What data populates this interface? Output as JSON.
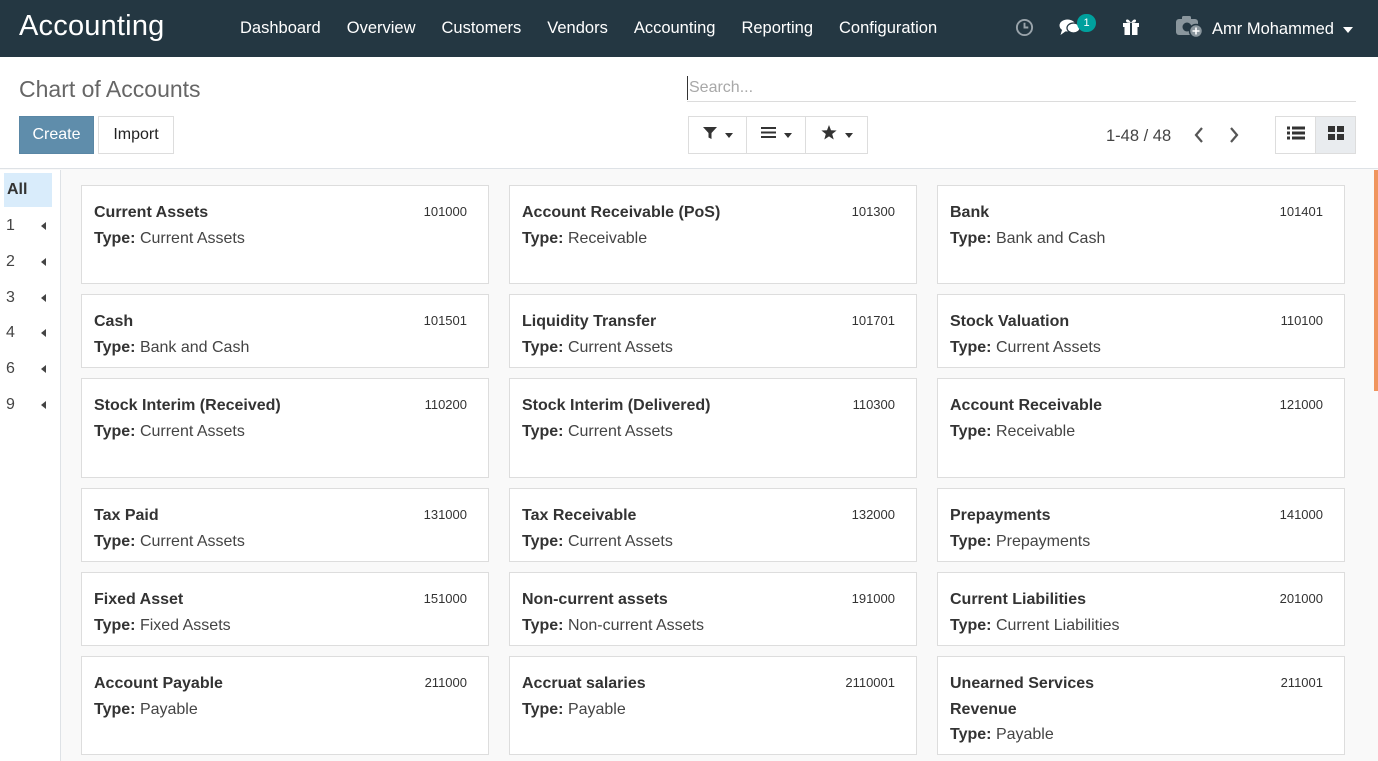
{
  "navbar": {
    "brand": "Accounting",
    "menu": [
      "Dashboard",
      "Overview",
      "Customers",
      "Vendors",
      "Accounting",
      "Reporting",
      "Configuration"
    ],
    "systray": {
      "activity_icon": "clock-icon",
      "messages_icon": "chat-icon",
      "messages_count": "1",
      "gift_icon": "gift-icon",
      "avatar_icon": "camera-avatar-icon",
      "user_name": "Amr Mohammed"
    }
  },
  "control_panel": {
    "title": "Chart of Accounts",
    "create_label": "Create",
    "import_label": "Import",
    "search_placeholder": "Search...",
    "search_value": "",
    "filter_icon": "filter-icon",
    "groupby_icon": "list-bars-icon",
    "favorites_icon": "star-icon",
    "pager": "1-48 / 48",
    "views": [
      {
        "name": "list",
        "icon": "list-view-icon",
        "active": false
      },
      {
        "name": "kanban",
        "icon": "kanban-view-icon",
        "active": true
      }
    ]
  },
  "sidebar": {
    "all_label": "All",
    "items": [
      "1",
      "2",
      "3",
      "4",
      "6",
      "9"
    ]
  },
  "colors": {
    "navbar": "#243742",
    "primary": "#5f8dab",
    "badge": "#00a09d",
    "sidebar_active": "#d9ecfb",
    "scroll_accent": "#f0955e"
  },
  "accounts": [
    {
      "name": "Current Assets",
      "code": "101000",
      "type_label": "Type:",
      "type": "Current Assets"
    },
    {
      "name": "Account Receivable (PoS)",
      "code": "101300",
      "type_label": "Type:",
      "type": "Receivable"
    },
    {
      "name": "Bank",
      "code": "101401",
      "type_label": "Type:",
      "type": "Bank and Cash"
    },
    {
      "name": "Cash",
      "code": "101501",
      "type_label": "Type:",
      "type": "Bank and Cash"
    },
    {
      "name": "Liquidity Transfer",
      "code": "101701",
      "type_label": "Type:",
      "type": "Current Assets"
    },
    {
      "name": "Stock Valuation",
      "code": "110100",
      "type_label": "Type:",
      "type": "Current Assets"
    },
    {
      "name": "Stock Interim (Received)",
      "code": "110200",
      "type_label": "Type:",
      "type": "Current Assets"
    },
    {
      "name": "Stock Interim (Delivered)",
      "code": "110300",
      "type_label": "Type:",
      "type": "Current Assets"
    },
    {
      "name": "Account Receivable",
      "code": "121000",
      "type_label": "Type:",
      "type": "Receivable"
    },
    {
      "name": "Tax Paid",
      "code": "131000",
      "type_label": "Type:",
      "type": "Current Assets"
    },
    {
      "name": "Tax Receivable",
      "code": "132000",
      "type_label": "Type:",
      "type": "Current Assets"
    },
    {
      "name": "Prepayments",
      "code": "141000",
      "type_label": "Type:",
      "type": "Prepayments"
    },
    {
      "name": "Fixed Asset",
      "code": "151000",
      "type_label": "Type:",
      "type": "Fixed Assets"
    },
    {
      "name": "Non-current assets",
      "code": "191000",
      "type_label": "Type:",
      "type": "Non-current Assets"
    },
    {
      "name": "Current Liabilities",
      "code": "201000",
      "type_label": "Type:",
      "type": "Current Liabilities"
    },
    {
      "name": "Account Payable",
      "code": "211000",
      "type_label": "Type:",
      "type": "Payable"
    },
    {
      "name": "Accruat salaries",
      "code": "2110001",
      "type_label": "Type:",
      "type": "Payable"
    },
    {
      "name": "Unearned Services Revenue",
      "code": "211001",
      "type_label": "Type:",
      "type": "Payable"
    }
  ]
}
